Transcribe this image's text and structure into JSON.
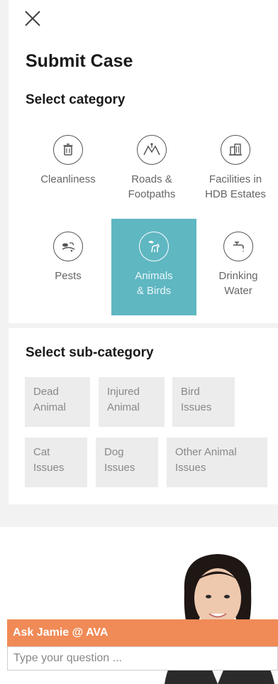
{
  "header": {
    "close_icon": "close-icon",
    "title": "Submit Case"
  },
  "category": {
    "heading": "Select category",
    "items": [
      {
        "label": "Cleanliness",
        "icon": "trash-can-icon",
        "selected": false
      },
      {
        "label": "Roads &\nFootpaths",
        "icon": "road-icon",
        "selected": false
      },
      {
        "label": "Facilities in\nHDB Estates",
        "icon": "building-icon",
        "selected": false
      },
      {
        "label": "Pests",
        "icon": "pest-icon",
        "selected": false
      },
      {
        "label": "Animals\n& Birds",
        "icon": "bird-dog-icon",
        "selected": true
      },
      {
        "label": "Drinking\nWater",
        "icon": "water-tap-icon",
        "selected": false
      }
    ],
    "selected_color": "#5fb7c2"
  },
  "subcategory": {
    "heading": "Select sub-category",
    "items": [
      {
        "label": "Dead\nAnimal"
      },
      {
        "label": "Injured\nAnimal"
      },
      {
        "label": "Bird\nIssues"
      },
      {
        "label": "Cat\nIssues"
      },
      {
        "label": "Dog\nIssues"
      },
      {
        "label": "Other Animal\nIssues"
      }
    ]
  },
  "chat": {
    "title": "Ask Jamie @ AVA",
    "placeholder": "Type your question ...",
    "bar_color": "#f08a56",
    "avatar_icon": "assistant-avatar-icon"
  }
}
